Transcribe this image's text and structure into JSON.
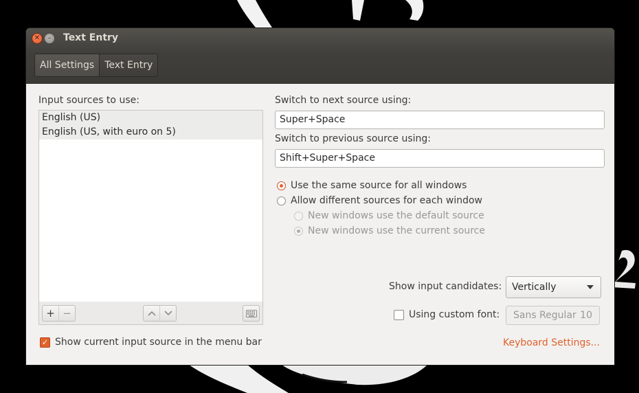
{
  "window": {
    "title": "Text Entry"
  },
  "navbar": {
    "items": [
      "All Settings",
      "Text Entry"
    ],
    "active": "All Settings"
  },
  "input_sources": {
    "label": "Input sources to use:",
    "items": [
      "English (US)",
      "English (US, with euro on 5)"
    ],
    "toolbar_icons": [
      "add-icon",
      "remove-icon",
      "move-up-icon",
      "move-down-icon",
      "keyboard-icon"
    ]
  },
  "switch": {
    "next_label": "Switch to next source using:",
    "next_value": "Super+Space",
    "prev_label": "Switch to previous source using:",
    "prev_value": "Shift+Super+Space"
  },
  "source_mode": {
    "same": "Use the same source for all windows",
    "different": "Allow different sources for each window",
    "default_source": "New windows use the default source",
    "current_source": "New windows use the current source",
    "selected": "same"
  },
  "candidates": {
    "label": "Show input candidates:",
    "value": "Vertically"
  },
  "custom_font": {
    "label": "Using custom font:",
    "checked": false,
    "font_name": "Sans Regular",
    "font_size": "10"
  },
  "menubar": {
    "label": "Show current input source in the menu bar",
    "checked": true
  },
  "keyboard_settings_link": "Keyboard Settings...",
  "colors": {
    "accent": "#e0622d",
    "titlebar": "#3f3d39",
    "window_bg": "#f2f1f0"
  }
}
